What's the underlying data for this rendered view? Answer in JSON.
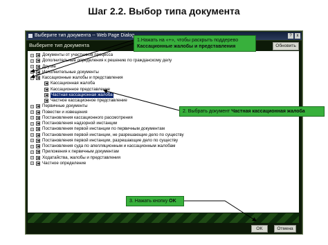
{
  "slide": {
    "title": "Шаг 2.2. Выбор типа документа"
  },
  "dialog": {
    "title": "Выберите тип документа -- Web Page Dialog",
    "help": "?",
    "close": "x",
    "section_label": "Выберите тип документа",
    "refresh_button": "Обновить",
    "ok_button": "OK",
    "cancel_button": "Отмена"
  },
  "tree": {
    "items": [
      {
        "label": "Документы от участников процесса",
        "level": 0,
        "expander": "+",
        "selected": false
      },
      {
        "label": "Дополнительные определения к решению по гражданскому делу",
        "level": 0,
        "expander": "+",
        "selected": false
      },
      {
        "label": "Другие",
        "level": 0,
        "expander": "+",
        "selected": false
      },
      {
        "label": "Исполнительные документы",
        "level": 0,
        "expander": "+",
        "selected": false
      },
      {
        "label": "Кассационные жалобы и представления",
        "level": 0,
        "expander": "−",
        "selected": false
      },
      {
        "label": "Кассационная жалоба",
        "level": 1,
        "expander": "",
        "selected": false
      },
      {
        "label": "Кассационное представление",
        "level": 1,
        "expander": "",
        "selected": false
      },
      {
        "label": "Частная кассационная жалоба",
        "level": 1,
        "expander": "",
        "selected": true
      },
      {
        "label": "Частное кассационное представление",
        "level": 1,
        "expander": "",
        "selected": false
      },
      {
        "label": "Первичные документы",
        "level": 0,
        "expander": "+",
        "selected": false
      },
      {
        "label": "Повестки и извещения",
        "level": 0,
        "expander": "+",
        "selected": false
      },
      {
        "label": "Постановления кассационного рассмотрения",
        "level": 0,
        "expander": "+",
        "selected": false
      },
      {
        "label": "Постановления надзорной инстанции",
        "level": 0,
        "expander": "+",
        "selected": false
      },
      {
        "label": "Постановления первой инстанции по первичным документам",
        "level": 0,
        "expander": "+",
        "selected": false
      },
      {
        "label": "Постановления первой инстанции, не разрешающие дело по существу",
        "level": 0,
        "expander": "+",
        "selected": false
      },
      {
        "label": "Постановления первой инстанции, разрешающие дело по существу",
        "level": 0,
        "expander": "+",
        "selected": false
      },
      {
        "label": "Постановления суда по апелляционным и кассационным жалобам",
        "level": 0,
        "expander": "+",
        "selected": false
      },
      {
        "label": "Приложения к первичным документам",
        "level": 0,
        "expander": "+",
        "selected": false
      },
      {
        "label": "Ходатайства, жалобы и представления",
        "level": 0,
        "expander": "+",
        "selected": false
      },
      {
        "label": "Частное определение",
        "level": 0,
        "expander": "+",
        "selected": false
      }
    ]
  },
  "callouts": {
    "step1_text": "1.Нажать на «+», чтобы раскрыть поддерево",
    "step1_bold": "Кассационные жалобы и представления",
    "step2_text": "2. Выбрать документ",
    "step2_bold": "Частная кассационная жалоба",
    "step3_text": "3. Нажать кнопку",
    "step3_bold": "OK"
  },
  "colors": {
    "callout_green": "#38b03c",
    "dialog_dark": "#0d1a08",
    "selection_blue": "#0a246a"
  },
  "icons": [
    "window-icon",
    "help-icon",
    "close-icon",
    "document-type-icon",
    "expand-plus-icon",
    "collapse-minus-icon"
  ]
}
